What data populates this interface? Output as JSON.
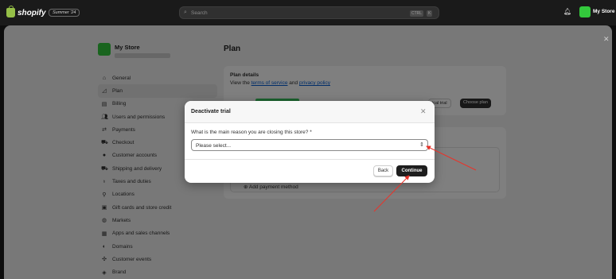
{
  "topbar": {
    "brand": "shopify",
    "edition_badge": "Summer '24",
    "search_placeholder": "Search",
    "shortcut_ctrl": "CTRL",
    "shortcut_key": "K",
    "store_name": "My Store"
  },
  "sidebar": {
    "store_title": "My Store",
    "items": [
      {
        "label": "General",
        "icon": "store-icon"
      },
      {
        "label": "Plan",
        "icon": "plan-icon"
      },
      {
        "label": "Billing",
        "icon": "billing-icon"
      },
      {
        "label": "Users and permissions",
        "icon": "users-icon"
      },
      {
        "label": "Payments",
        "icon": "payments-icon"
      },
      {
        "label": "Checkout",
        "icon": "cart-icon"
      },
      {
        "label": "Customer accounts",
        "icon": "person-icon"
      },
      {
        "label": "Shipping and delivery",
        "icon": "truck-icon"
      },
      {
        "label": "Taxes and duties",
        "icon": "tax-icon"
      },
      {
        "label": "Locations",
        "icon": "location-icon"
      },
      {
        "label": "Gift cards and store credit",
        "icon": "gift-card-icon"
      },
      {
        "label": "Markets",
        "icon": "globe-icon"
      },
      {
        "label": "Apps and sales channels",
        "icon": "apps-icon"
      },
      {
        "label": "Domains",
        "icon": "domain-icon"
      },
      {
        "label": "Customer events",
        "icon": "events-icon"
      },
      {
        "label": "Brand",
        "icon": "brand-icon"
      }
    ]
  },
  "main": {
    "title": "Plan",
    "plan_details": {
      "heading": "Plan details",
      "text_prefix": "View the ",
      "terms_link": "terms of service",
      "text_mid": " and ",
      "privacy_link": "privacy policy",
      "trial_button": "ical trial",
      "choose_plan_button": "Choose plan"
    },
    "add_payment": "Add payment method"
  },
  "modal": {
    "title": "Deactivate trial",
    "question": "What is the main reason you are closing this store? *",
    "select_value": "Please select...",
    "back_label": "Back",
    "continue_label": "Continue"
  },
  "colors": {
    "accent_green": "#33c93c",
    "annotation_red": "#e8332a",
    "primary_button": "#1e1e1e"
  }
}
